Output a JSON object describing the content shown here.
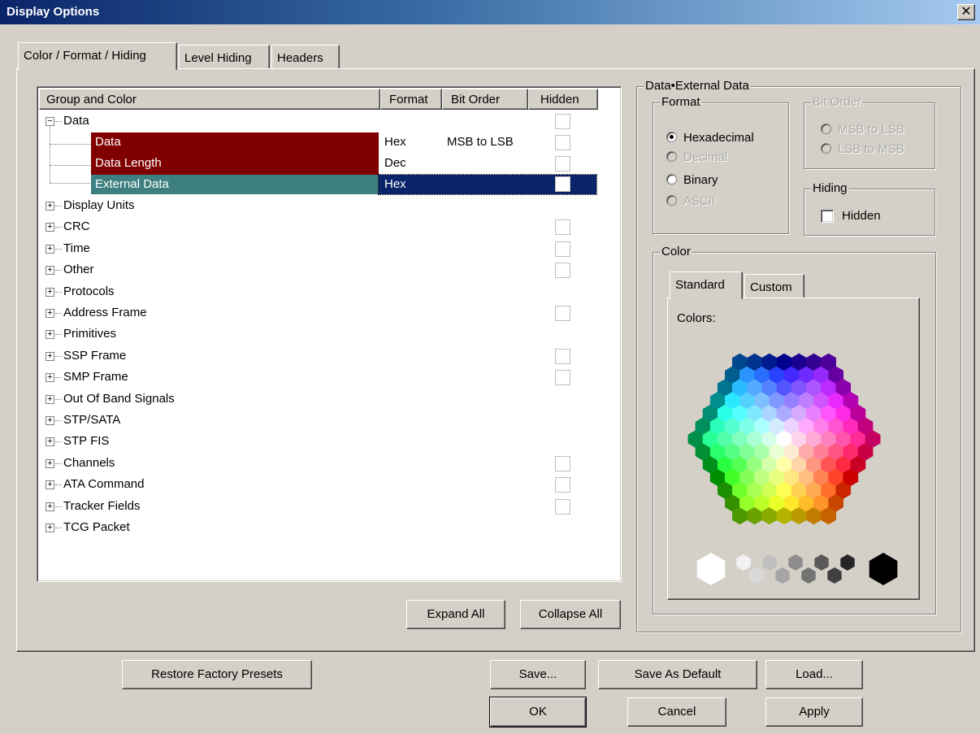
{
  "window": {
    "title": "Display Options",
    "close_glyph": "✕"
  },
  "tabs": [
    {
      "label": "Color / Format / Hiding",
      "active": true
    },
    {
      "label": "Level Hiding",
      "active": false
    },
    {
      "label": "Headers",
      "active": false
    }
  ],
  "grid": {
    "columns": [
      "Group and Color",
      "Format",
      "Bit Order",
      "Hidden"
    ],
    "expanded_group": {
      "label": "Data",
      "toggle": "−"
    },
    "children": [
      {
        "name": "Data",
        "format": "Hex",
        "bit_order": "MSB to LSB",
        "color": "#800000",
        "selected": false
      },
      {
        "name": "Data Length",
        "format": "Dec",
        "bit_order": "",
        "color": "#800000",
        "selected": false
      },
      {
        "name": "External Data",
        "format": "Hex",
        "bit_order": "",
        "color": "#3e8080",
        "selected": true
      }
    ],
    "groups": [
      {
        "label": "Display Units",
        "has_hidden": false
      },
      {
        "label": "CRC",
        "has_hidden": true
      },
      {
        "label": "Time",
        "has_hidden": true
      },
      {
        "label": "Other",
        "has_hidden": true
      },
      {
        "label": "Protocols",
        "has_hidden": false
      },
      {
        "label": "Address Frame",
        "has_hidden": true
      },
      {
        "label": "Primitives",
        "has_hidden": false
      },
      {
        "label": "SSP Frame",
        "has_hidden": true
      },
      {
        "label": "SMP Frame",
        "has_hidden": true
      },
      {
        "label": "Out Of Band Signals",
        "has_hidden": false
      },
      {
        "label": "STP/SATA",
        "has_hidden": false
      },
      {
        "label": "STP FIS",
        "has_hidden": false
      },
      {
        "label": "Channels",
        "has_hidden": true
      },
      {
        "label": "ATA Command",
        "has_hidden": true
      },
      {
        "label": "Tracker Fields",
        "has_hidden": true
      },
      {
        "label": "TCG Packet",
        "has_hidden": false
      }
    ],
    "expand_glyph": "+",
    "expand_all": "Expand All",
    "collapse_all": "Collapse All"
  },
  "right_panel": {
    "title": "Data•External Data",
    "format": {
      "legend": "Format",
      "options": [
        {
          "label": "Hexadecimal",
          "checked": true,
          "enabled": true
        },
        {
          "label": "Decimal",
          "checked": false,
          "enabled": false
        },
        {
          "label": "Binary",
          "checked": false,
          "enabled": true
        },
        {
          "label": "ASCII",
          "checked": false,
          "enabled": false
        }
      ]
    },
    "bit_order": {
      "legend": "Bit Order",
      "options": [
        {
          "label": "MSB to LSB",
          "enabled": false
        },
        {
          "label": "LSB to MSB",
          "enabled": false
        }
      ]
    },
    "hiding": {
      "legend": "Hiding",
      "hidden_label": "Hidden",
      "hidden_checked": false
    },
    "color": {
      "legend": "Color",
      "tabs": [
        {
          "label": "Standard",
          "active": true
        },
        {
          "label": "Custom",
          "active": false
        }
      ],
      "colors_label": "Colors:"
    }
  },
  "buttons": {
    "restore": "Restore Factory Presets",
    "save": "Save...",
    "save_default": "Save As Default",
    "load": "Load...",
    "ok": "OK",
    "cancel": "Cancel",
    "apply": "Apply"
  },
  "colors": {
    "selection": "#0a246a",
    "title_active": "#0a246a"
  }
}
